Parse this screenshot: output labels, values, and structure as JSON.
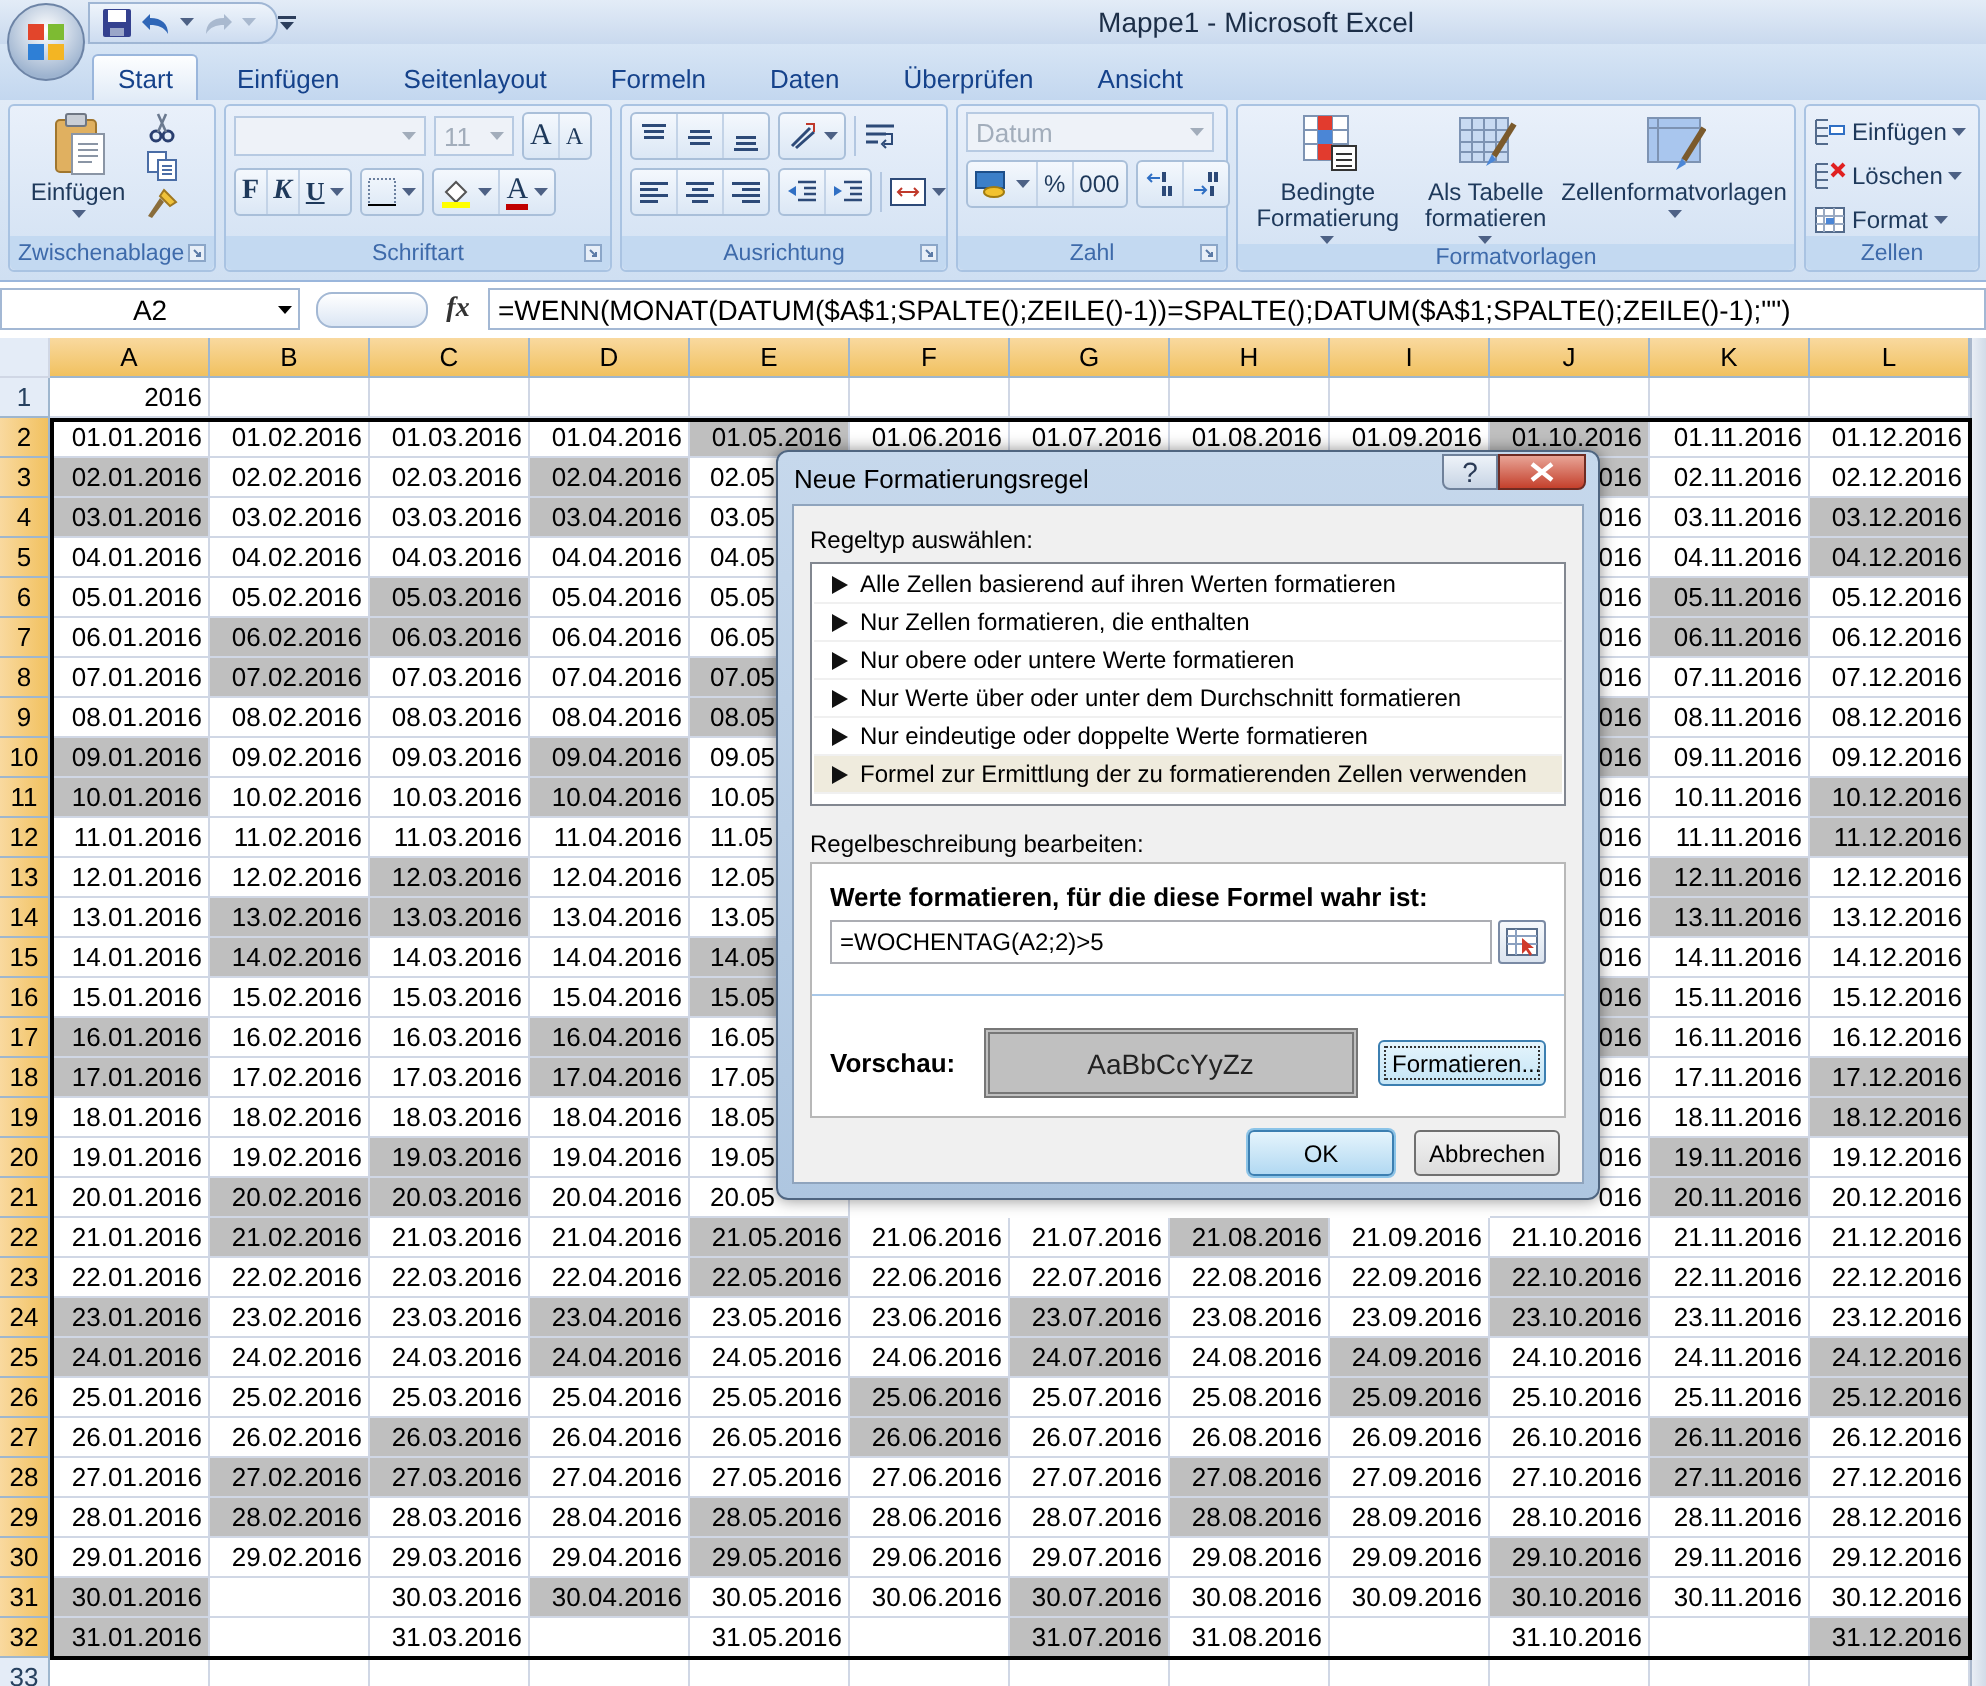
{
  "window": {
    "title": "Mappe1 - Microsoft Excel"
  },
  "ribbon": {
    "tabs": [
      {
        "label": "Start",
        "selected": true
      },
      {
        "label": "Einfügen",
        "selected": false
      },
      {
        "label": "Seitenlayout",
        "selected": false
      },
      {
        "label": "Formeln",
        "selected": false
      },
      {
        "label": "Daten",
        "selected": false
      },
      {
        "label": "Überprüfen",
        "selected": false
      },
      {
        "label": "Ansicht",
        "selected": false
      }
    ],
    "groups": [
      {
        "label": "Zwischenablage",
        "launcher": true
      },
      {
        "label": "Schriftart",
        "launcher": true
      },
      {
        "label": "Ausrichtung",
        "launcher": true
      },
      {
        "label": "Zahl",
        "launcher": true
      },
      {
        "label": "Formatvorlagen",
        "launcher": false
      },
      {
        "label": "Zellen",
        "launcher": false
      }
    ],
    "paste": "Einfügen",
    "font_name": {
      "disabled": true
    },
    "font_size": {
      "value": "11",
      "disabled": true
    },
    "font_grow": "A",
    "font_shrink": "A",
    "bold": "F",
    "italic": "K",
    "underline": "U",
    "font_color": "A",
    "number_format": {
      "value": "Datum",
      "disabled": true
    },
    "percent": "%",
    "thousands": "000",
    "style_buttons": [
      "Bedingte Formatierung",
      "Als Tabelle formatieren",
      "Zellenformatvorlagen"
    ],
    "cell_buttons": [
      "Einfügen",
      "Löschen",
      "Format"
    ]
  },
  "formula_bar": {
    "name_box": "A2",
    "fx": "fx",
    "formula": "=WENN(MONAT(DATUM($A$1;SPALTE();ZEILE()-1))=SPALTE();DATUM($A$1;SPALTE();ZEILE()-1);\"\")"
  },
  "sheet": {
    "columns": [
      {
        "label": "A",
        "selected": true
      },
      {
        "label": "B",
        "selected": true
      },
      {
        "label": "C",
        "selected": true
      },
      {
        "label": "D",
        "selected": true
      },
      {
        "label": "E",
        "selected": true
      },
      {
        "label": "F",
        "selected": true
      },
      {
        "label": "G",
        "selected": true
      },
      {
        "label": "H",
        "selected": true
      },
      {
        "label": "I",
        "selected": true
      },
      {
        "label": "J",
        "selected": true
      },
      {
        "label": "K",
        "selected": true
      },
      {
        "label": "L",
        "selected": true
      }
    ],
    "rows": [
      {
        "num": "1",
        "selected": false,
        "cells": [
          {
            "text": "2016",
            "shaded": false
          }
        ]
      },
      {
        "num": "2",
        "selected": true,
        "cells": [
          {
            "text": "01.01.2016",
            "shaded": false
          },
          {
            "text": "01.02.2016",
            "shaded": false
          },
          {
            "text": "01.03.2016",
            "shaded": false
          },
          {
            "text": "01.04.2016",
            "shaded": false
          },
          {
            "text": "01.05.2016",
            "shaded": true
          },
          {
            "text": "01.06.2016",
            "shaded": false
          },
          {
            "text": "01.07.2016",
            "shaded": false
          },
          {
            "text": "01.08.2016",
            "shaded": false
          },
          {
            "text": "01.09.2016",
            "shaded": false
          },
          {
            "text": "01.10.2016",
            "shaded": true
          },
          {
            "text": "01.11.2016",
            "shaded": false
          },
          {
            "text": "01.12.2016",
            "shaded": false
          }
        ]
      },
      {
        "num": "3",
        "selected": true,
        "cells": [
          {
            "text": "02.01.2016",
            "shaded": true
          },
          {
            "text": "02.02.2016",
            "shaded": false
          },
          {
            "text": "02.03.2016",
            "shaded": false
          },
          {
            "text": "02.04.2016",
            "shaded": true
          },
          {
            "text": "02.05",
            "shaded": false,
            "clipped": true
          },
          null,
          null,
          null,
          null,
          {
            "text": "016",
            "shaded": true
          },
          {
            "text": "02.11.2016",
            "shaded": false
          },
          {
            "text": "02.12.2016",
            "shaded": false
          }
        ]
      },
      {
        "num": "4",
        "selected": true,
        "cells": [
          {
            "text": "03.01.2016",
            "shaded": true
          },
          {
            "text": "03.02.2016",
            "shaded": false
          },
          {
            "text": "03.03.2016",
            "shaded": false
          },
          {
            "text": "03.04.2016",
            "shaded": true
          },
          {
            "text": "03.05",
            "shaded": false,
            "clipped": true
          },
          null,
          null,
          null,
          null,
          {
            "text": "016",
            "shaded": false
          },
          {
            "text": "03.11.2016",
            "shaded": false
          },
          {
            "text": "03.12.2016",
            "shaded": true
          }
        ]
      },
      {
        "num": "5",
        "selected": true,
        "cells": [
          {
            "text": "04.01.2016",
            "shaded": false
          },
          {
            "text": "04.02.2016",
            "shaded": false
          },
          {
            "text": "04.03.2016",
            "shaded": false
          },
          {
            "text": "04.04.2016",
            "shaded": false
          },
          {
            "text": "04.05",
            "shaded": false,
            "clipped": true
          },
          null,
          null,
          null,
          null,
          {
            "text": "016",
            "shaded": false
          },
          {
            "text": "04.11.2016",
            "shaded": false
          },
          {
            "text": "04.12.2016",
            "shaded": true
          }
        ]
      },
      {
        "num": "6",
        "selected": true,
        "cells": [
          {
            "text": "05.01.2016",
            "shaded": false
          },
          {
            "text": "05.02.2016",
            "shaded": false
          },
          {
            "text": "05.03.2016",
            "shaded": true
          },
          {
            "text": "05.04.2016",
            "shaded": false
          },
          {
            "text": "05.05",
            "shaded": false,
            "clipped": true
          },
          null,
          null,
          null,
          null,
          {
            "text": "016",
            "shaded": false
          },
          {
            "text": "05.11.2016",
            "shaded": true
          },
          {
            "text": "05.12.2016",
            "shaded": false
          }
        ]
      },
      {
        "num": "7",
        "selected": true,
        "cells": [
          {
            "text": "06.01.2016",
            "shaded": false
          },
          {
            "text": "06.02.2016",
            "shaded": true
          },
          {
            "text": "06.03.2016",
            "shaded": true
          },
          {
            "text": "06.04.2016",
            "shaded": false
          },
          {
            "text": "06.05",
            "shaded": false,
            "clipped": true
          },
          null,
          null,
          null,
          null,
          {
            "text": "016",
            "shaded": false
          },
          {
            "text": "06.11.2016",
            "shaded": true
          },
          {
            "text": "06.12.2016",
            "shaded": false
          }
        ]
      },
      {
        "num": "8",
        "selected": true,
        "cells": [
          {
            "text": "07.01.2016",
            "shaded": false
          },
          {
            "text": "07.02.2016",
            "shaded": true
          },
          {
            "text": "07.03.2016",
            "shaded": false
          },
          {
            "text": "07.04.2016",
            "shaded": false
          },
          {
            "text": "07.05",
            "shaded": true,
            "clipped": true
          },
          null,
          null,
          null,
          null,
          {
            "text": "016",
            "shaded": false
          },
          {
            "text": "07.11.2016",
            "shaded": false
          },
          {
            "text": "07.12.2016",
            "shaded": false
          }
        ]
      },
      {
        "num": "9",
        "selected": true,
        "cells": [
          {
            "text": "08.01.2016",
            "shaded": false
          },
          {
            "text": "08.02.2016",
            "shaded": false
          },
          {
            "text": "08.03.2016",
            "shaded": false
          },
          {
            "text": "08.04.2016",
            "shaded": false
          },
          {
            "text": "08.05",
            "shaded": true,
            "clipped": true
          },
          null,
          null,
          null,
          null,
          {
            "text": "016",
            "shaded": true
          },
          {
            "text": "08.11.2016",
            "shaded": false
          },
          {
            "text": "08.12.2016",
            "shaded": false
          }
        ]
      },
      {
        "num": "10",
        "selected": true,
        "cells": [
          {
            "text": "09.01.2016",
            "shaded": true
          },
          {
            "text": "09.02.2016",
            "shaded": false
          },
          {
            "text": "09.03.2016",
            "shaded": false
          },
          {
            "text": "09.04.2016",
            "shaded": true
          },
          {
            "text": "09.05",
            "shaded": false,
            "clipped": true
          },
          null,
          null,
          null,
          null,
          {
            "text": "016",
            "shaded": true
          },
          {
            "text": "09.11.2016",
            "shaded": false
          },
          {
            "text": "09.12.2016",
            "shaded": false
          }
        ]
      },
      {
        "num": "11",
        "selected": true,
        "cells": [
          {
            "text": "10.01.2016",
            "shaded": true
          },
          {
            "text": "10.02.2016",
            "shaded": false
          },
          {
            "text": "10.03.2016",
            "shaded": false
          },
          {
            "text": "10.04.2016",
            "shaded": true
          },
          {
            "text": "10.05",
            "shaded": false,
            "clipped": true
          },
          null,
          null,
          null,
          null,
          {
            "text": "016",
            "shaded": false
          },
          {
            "text": "10.11.2016",
            "shaded": false
          },
          {
            "text": "10.12.2016",
            "shaded": true
          }
        ]
      },
      {
        "num": "12",
        "selected": true,
        "cells": [
          {
            "text": "11.01.2016",
            "shaded": false
          },
          {
            "text": "11.02.2016",
            "shaded": false
          },
          {
            "text": "11.03.2016",
            "shaded": false
          },
          {
            "text": "11.04.2016",
            "shaded": false
          },
          {
            "text": "11.05",
            "shaded": false,
            "clipped": true
          },
          null,
          null,
          null,
          null,
          {
            "text": "016",
            "shaded": false
          },
          {
            "text": "11.11.2016",
            "shaded": false
          },
          {
            "text": "11.12.2016",
            "shaded": true
          }
        ]
      },
      {
        "num": "13",
        "selected": true,
        "cells": [
          {
            "text": "12.01.2016",
            "shaded": false
          },
          {
            "text": "12.02.2016",
            "shaded": false
          },
          {
            "text": "12.03.2016",
            "shaded": true
          },
          {
            "text": "12.04.2016",
            "shaded": false
          },
          {
            "text": "12.05",
            "shaded": false,
            "clipped": true
          },
          null,
          null,
          null,
          null,
          {
            "text": "016",
            "shaded": false
          },
          {
            "text": "12.11.2016",
            "shaded": true
          },
          {
            "text": "12.12.2016",
            "shaded": false
          }
        ]
      },
      {
        "num": "14",
        "selected": true,
        "cells": [
          {
            "text": "13.01.2016",
            "shaded": false
          },
          {
            "text": "13.02.2016",
            "shaded": true
          },
          {
            "text": "13.03.2016",
            "shaded": true
          },
          {
            "text": "13.04.2016",
            "shaded": false
          },
          {
            "text": "13.05",
            "shaded": false,
            "clipped": true
          },
          null,
          null,
          null,
          null,
          {
            "text": "016",
            "shaded": false
          },
          {
            "text": "13.11.2016",
            "shaded": true
          },
          {
            "text": "13.12.2016",
            "shaded": false
          }
        ]
      },
      {
        "num": "15",
        "selected": true,
        "cells": [
          {
            "text": "14.01.2016",
            "shaded": false
          },
          {
            "text": "14.02.2016",
            "shaded": true
          },
          {
            "text": "14.03.2016",
            "shaded": false
          },
          {
            "text": "14.04.2016",
            "shaded": false
          },
          {
            "text": "14.05",
            "shaded": true,
            "clipped": true
          },
          null,
          null,
          null,
          null,
          {
            "text": "016",
            "shaded": false
          },
          {
            "text": "14.11.2016",
            "shaded": false
          },
          {
            "text": "14.12.2016",
            "shaded": false
          }
        ]
      },
      {
        "num": "16",
        "selected": true,
        "cells": [
          {
            "text": "15.01.2016",
            "shaded": false
          },
          {
            "text": "15.02.2016",
            "shaded": false
          },
          {
            "text": "15.03.2016",
            "shaded": false
          },
          {
            "text": "15.04.2016",
            "shaded": false
          },
          {
            "text": "15.05",
            "shaded": true,
            "clipped": true
          },
          null,
          null,
          null,
          null,
          {
            "text": "016",
            "shaded": true
          },
          {
            "text": "15.11.2016",
            "shaded": false
          },
          {
            "text": "15.12.2016",
            "shaded": false
          }
        ]
      },
      {
        "num": "17",
        "selected": true,
        "cells": [
          {
            "text": "16.01.2016",
            "shaded": true
          },
          {
            "text": "16.02.2016",
            "shaded": false
          },
          {
            "text": "16.03.2016",
            "shaded": false
          },
          {
            "text": "16.04.2016",
            "shaded": true
          },
          {
            "text": "16.05",
            "shaded": false,
            "clipped": true
          },
          null,
          null,
          null,
          null,
          {
            "text": "016",
            "shaded": true
          },
          {
            "text": "16.11.2016",
            "shaded": false
          },
          {
            "text": "16.12.2016",
            "shaded": false
          }
        ]
      },
      {
        "num": "18",
        "selected": true,
        "cells": [
          {
            "text": "17.01.2016",
            "shaded": true
          },
          {
            "text": "17.02.2016",
            "shaded": false
          },
          {
            "text": "17.03.2016",
            "shaded": false
          },
          {
            "text": "17.04.2016",
            "shaded": true
          },
          {
            "text": "17.05",
            "shaded": false,
            "clipped": true
          },
          null,
          null,
          null,
          null,
          {
            "text": "016",
            "shaded": false
          },
          {
            "text": "17.11.2016",
            "shaded": false
          },
          {
            "text": "17.12.2016",
            "shaded": true
          }
        ]
      },
      {
        "num": "19",
        "selected": true,
        "cells": [
          {
            "text": "18.01.2016",
            "shaded": false
          },
          {
            "text": "18.02.2016",
            "shaded": false
          },
          {
            "text": "18.03.2016",
            "shaded": false
          },
          {
            "text": "18.04.2016",
            "shaded": false
          },
          {
            "text": "18.05",
            "shaded": false,
            "clipped": true
          },
          null,
          null,
          null,
          null,
          {
            "text": "016",
            "shaded": false
          },
          {
            "text": "18.11.2016",
            "shaded": false
          },
          {
            "text": "18.12.2016",
            "shaded": true
          }
        ]
      },
      {
        "num": "20",
        "selected": true,
        "cells": [
          {
            "text": "19.01.2016",
            "shaded": false
          },
          {
            "text": "19.02.2016",
            "shaded": false
          },
          {
            "text": "19.03.2016",
            "shaded": true
          },
          {
            "text": "19.04.2016",
            "shaded": false
          },
          {
            "text": "19.05",
            "shaded": false,
            "clipped": true
          },
          null,
          null,
          null,
          null,
          {
            "text": "016",
            "shaded": false
          },
          {
            "text": "19.11.2016",
            "shaded": true
          },
          {
            "text": "19.12.2016",
            "shaded": false
          }
        ]
      },
      {
        "num": "21",
        "selected": true,
        "cells": [
          {
            "text": "20.01.2016",
            "shaded": false
          },
          {
            "text": "20.02.2016",
            "shaded": true
          },
          {
            "text": "20.03.2016",
            "shaded": true
          },
          {
            "text": "20.04.2016",
            "shaded": false
          },
          {
            "text": "20.05",
            "shaded": false,
            "clipped": true
          },
          null,
          null,
          null,
          null,
          {
            "text": "016",
            "shaded": false
          },
          {
            "text": "20.11.2016",
            "shaded": true
          },
          {
            "text": "20.12.2016",
            "shaded": false
          }
        ]
      },
      {
        "num": "22",
        "selected": true,
        "cells": [
          {
            "text": "21.01.2016",
            "shaded": false
          },
          {
            "text": "21.02.2016",
            "shaded": true
          },
          {
            "text": "21.03.2016",
            "shaded": false
          },
          {
            "text": "21.04.2016",
            "shaded": false
          },
          {
            "text": "21.05.2016",
            "shaded": true
          },
          {
            "text": "21.06.2016",
            "shaded": false
          },
          {
            "text": "21.07.2016",
            "shaded": false
          },
          {
            "text": "21.08.2016",
            "shaded": true
          },
          {
            "text": "21.09.2016",
            "shaded": false
          },
          {
            "text": "21.10.2016",
            "shaded": false
          },
          {
            "text": "21.11.2016",
            "shaded": false
          },
          {
            "text": "21.12.2016",
            "shaded": false
          }
        ]
      },
      {
        "num": "23",
        "selected": true,
        "cells": [
          {
            "text": "22.01.2016",
            "shaded": false
          },
          {
            "text": "22.02.2016",
            "shaded": false
          },
          {
            "text": "22.03.2016",
            "shaded": false
          },
          {
            "text": "22.04.2016",
            "shaded": false
          },
          {
            "text": "22.05.2016",
            "shaded": true
          },
          {
            "text": "22.06.2016",
            "shaded": false
          },
          {
            "text": "22.07.2016",
            "shaded": false
          },
          {
            "text": "22.08.2016",
            "shaded": false
          },
          {
            "text": "22.09.2016",
            "shaded": false
          },
          {
            "text": "22.10.2016",
            "shaded": true
          },
          {
            "text": "22.11.2016",
            "shaded": false
          },
          {
            "text": "22.12.2016",
            "shaded": false
          }
        ]
      },
      {
        "num": "24",
        "selected": true,
        "cells": [
          {
            "text": "23.01.2016",
            "shaded": true
          },
          {
            "text": "23.02.2016",
            "shaded": false
          },
          {
            "text": "23.03.2016",
            "shaded": false
          },
          {
            "text": "23.04.2016",
            "shaded": true
          },
          {
            "text": "23.05.2016",
            "shaded": false
          },
          {
            "text": "23.06.2016",
            "shaded": false
          },
          {
            "text": "23.07.2016",
            "shaded": true
          },
          {
            "text": "23.08.2016",
            "shaded": false
          },
          {
            "text": "23.09.2016",
            "shaded": false
          },
          {
            "text": "23.10.2016",
            "shaded": true
          },
          {
            "text": "23.11.2016",
            "shaded": false
          },
          {
            "text": "23.12.2016",
            "shaded": false
          }
        ]
      },
      {
        "num": "25",
        "selected": true,
        "cells": [
          {
            "text": "24.01.2016",
            "shaded": true
          },
          {
            "text": "24.02.2016",
            "shaded": false
          },
          {
            "text": "24.03.2016",
            "shaded": false
          },
          {
            "text": "24.04.2016",
            "shaded": true
          },
          {
            "text": "24.05.2016",
            "shaded": false
          },
          {
            "text": "24.06.2016",
            "shaded": false
          },
          {
            "text": "24.07.2016",
            "shaded": true
          },
          {
            "text": "24.08.2016",
            "shaded": false
          },
          {
            "text": "24.09.2016",
            "shaded": true
          },
          {
            "text": "24.10.2016",
            "shaded": false
          },
          {
            "text": "24.11.2016",
            "shaded": false
          },
          {
            "text": "24.12.2016",
            "shaded": true
          }
        ]
      },
      {
        "num": "26",
        "selected": true,
        "cells": [
          {
            "text": "25.01.2016",
            "shaded": false
          },
          {
            "text": "25.02.2016",
            "shaded": false
          },
          {
            "text": "25.03.2016",
            "shaded": false
          },
          {
            "text": "25.04.2016",
            "shaded": false
          },
          {
            "text": "25.05.2016",
            "shaded": false
          },
          {
            "text": "25.06.2016",
            "shaded": true
          },
          {
            "text": "25.07.2016",
            "shaded": false
          },
          {
            "text": "25.08.2016",
            "shaded": false
          },
          {
            "text": "25.09.2016",
            "shaded": true
          },
          {
            "text": "25.10.2016",
            "shaded": false
          },
          {
            "text": "25.11.2016",
            "shaded": false
          },
          {
            "text": "25.12.2016",
            "shaded": true
          }
        ]
      },
      {
        "num": "27",
        "selected": true,
        "cells": [
          {
            "text": "26.01.2016",
            "shaded": false
          },
          {
            "text": "26.02.2016",
            "shaded": false
          },
          {
            "text": "26.03.2016",
            "shaded": true
          },
          {
            "text": "26.04.2016",
            "shaded": false
          },
          {
            "text": "26.05.2016",
            "shaded": false
          },
          {
            "text": "26.06.2016",
            "shaded": true
          },
          {
            "text": "26.07.2016",
            "shaded": false
          },
          {
            "text": "26.08.2016",
            "shaded": false
          },
          {
            "text": "26.09.2016",
            "shaded": false
          },
          {
            "text": "26.10.2016",
            "shaded": false
          },
          {
            "text": "26.11.2016",
            "shaded": true
          },
          {
            "text": "26.12.2016",
            "shaded": false
          }
        ]
      },
      {
        "num": "28",
        "selected": true,
        "cells": [
          {
            "text": "27.01.2016",
            "shaded": false
          },
          {
            "text": "27.02.2016",
            "shaded": true
          },
          {
            "text": "27.03.2016",
            "shaded": true
          },
          {
            "text": "27.04.2016",
            "shaded": false
          },
          {
            "text": "27.05.2016",
            "shaded": false
          },
          {
            "text": "27.06.2016",
            "shaded": false
          },
          {
            "text": "27.07.2016",
            "shaded": false
          },
          {
            "text": "27.08.2016",
            "shaded": true
          },
          {
            "text": "27.09.2016",
            "shaded": false
          },
          {
            "text": "27.10.2016",
            "shaded": false
          },
          {
            "text": "27.11.2016",
            "shaded": true
          },
          {
            "text": "27.12.2016",
            "shaded": false
          }
        ]
      },
      {
        "num": "29",
        "selected": true,
        "cells": [
          {
            "text": "28.01.2016",
            "shaded": false
          },
          {
            "text": "28.02.2016",
            "shaded": true
          },
          {
            "text": "28.03.2016",
            "shaded": false
          },
          {
            "text": "28.04.2016",
            "shaded": false
          },
          {
            "text": "28.05.2016",
            "shaded": true
          },
          {
            "text": "28.06.2016",
            "shaded": false
          },
          {
            "text": "28.07.2016",
            "shaded": false
          },
          {
            "text": "28.08.2016",
            "shaded": true
          },
          {
            "text": "28.09.2016",
            "shaded": false
          },
          {
            "text": "28.10.2016",
            "shaded": false
          },
          {
            "text": "28.11.2016",
            "shaded": false
          },
          {
            "text": "28.12.2016",
            "shaded": false
          }
        ]
      },
      {
        "num": "30",
        "selected": true,
        "cells": [
          {
            "text": "29.01.2016",
            "shaded": false
          },
          {
            "text": "29.02.2016",
            "shaded": false
          },
          {
            "text": "29.03.2016",
            "shaded": false
          },
          {
            "text": "29.04.2016",
            "shaded": false
          },
          {
            "text": "29.05.2016",
            "shaded": true
          },
          {
            "text": "29.06.2016",
            "shaded": false
          },
          {
            "text": "29.07.2016",
            "shaded": false
          },
          {
            "text": "29.08.2016",
            "shaded": false
          },
          {
            "text": "29.09.2016",
            "shaded": false
          },
          {
            "text": "29.10.2016",
            "shaded": true
          },
          {
            "text": "29.11.2016",
            "shaded": false
          },
          {
            "text": "29.12.2016",
            "shaded": false
          }
        ]
      },
      {
        "num": "31",
        "selected": true,
        "cells": [
          {
            "text": "30.01.2016",
            "shaded": true
          },
          {},
          {
            "text": "30.03.2016",
            "shaded": false
          },
          {
            "text": "30.04.2016",
            "shaded": true
          },
          {
            "text": "30.05.2016",
            "shaded": false
          },
          {
            "text": "30.06.2016",
            "shaded": false
          },
          {
            "text": "30.07.2016",
            "shaded": true
          },
          {
            "text": "30.08.2016",
            "shaded": false
          },
          {
            "text": "30.09.2016",
            "shaded": false
          },
          {
            "text": "30.10.2016",
            "shaded": true
          },
          {
            "text": "30.11.2016",
            "shaded": false
          },
          {
            "text": "30.12.2016",
            "shaded": false
          }
        ]
      },
      {
        "num": "32",
        "selected": true,
        "cells": [
          {
            "text": "31.01.2016",
            "shaded": true
          },
          {},
          {
            "text": "31.03.2016",
            "shaded": false
          },
          {},
          {
            "text": "31.05.2016",
            "shaded": false
          },
          {},
          {
            "text": "31.07.2016",
            "shaded": true
          },
          {
            "text": "31.08.2016",
            "shaded": false
          },
          {},
          {
            "text": "31.10.2016",
            "shaded": false
          },
          {},
          {
            "text": "31.12.2016",
            "shaded": true
          }
        ]
      },
      {
        "num": "33",
        "selected": false
      }
    ]
  },
  "dialog": {
    "title": "Neue Formatierungsregel",
    "help": "?",
    "rule_type_label": "Regeltyp auswählen:",
    "rule_types": [
      {
        "label": "Alle Zellen basierend auf ihren Werten formatieren",
        "selected": false
      },
      {
        "label": "Nur Zellen formatieren, die enthalten",
        "selected": false
      },
      {
        "label": "Nur obere oder untere Werte formatieren",
        "selected": false
      },
      {
        "label": "Nur Werte über oder unter dem Durchschnitt formatieren",
        "selected": false
      },
      {
        "label": "Nur eindeutige oder doppelte Werte formatieren",
        "selected": false
      },
      {
        "label": "Formel zur Ermittlung der zu formatierenden Zellen verwenden",
        "selected": true
      }
    ],
    "description_label": "Regelbeschreibung bearbeiten:",
    "formula_label": "Werte formatieren, für die diese Formel wahr ist:",
    "formula": "=WOCHENTAG(A2;2)>5",
    "preview_label": "Vorschau:",
    "preview_text": "AaBbCcYyZz",
    "format_button": "Formatieren...",
    "buttons": [
      {
        "label": "OK",
        "default": true
      },
      {
        "label": "Abbrechen",
        "default": false
      }
    ]
  }
}
